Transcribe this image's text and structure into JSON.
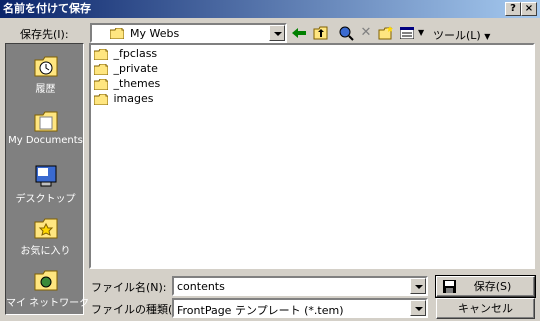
{
  "window": {
    "title": "名前を付けて保存",
    "help_btn": "?",
    "close_btn": "×"
  },
  "toolbar": {
    "save_in_label": "保存先(I):",
    "location": "My Webs",
    "tools_label": "ツール(L)"
  },
  "places": [
    {
      "label": "履歴",
      "icon": "history-folder-icon"
    },
    {
      "label": "My Documents",
      "icon": "documents-folder-icon"
    },
    {
      "label": "デスクトップ",
      "icon": "desktop-icon"
    },
    {
      "label": "お気に入り",
      "icon": "favorites-folder-icon"
    },
    {
      "label": "マイ ネットワーク",
      "icon": "network-folder-icon"
    }
  ],
  "files": [
    {
      "name": "_fpclass"
    },
    {
      "name": "_private"
    },
    {
      "name": "_themes"
    },
    {
      "name": "images"
    }
  ],
  "form": {
    "filename_label": "ファイル名(N):",
    "filename_value": "contents",
    "filetype_label": "ファイルの種類(T):",
    "filetype_value": "FrontPage テンプレート (*.tem)",
    "save_button": "保存(S)",
    "cancel_button": "キャンセル"
  }
}
